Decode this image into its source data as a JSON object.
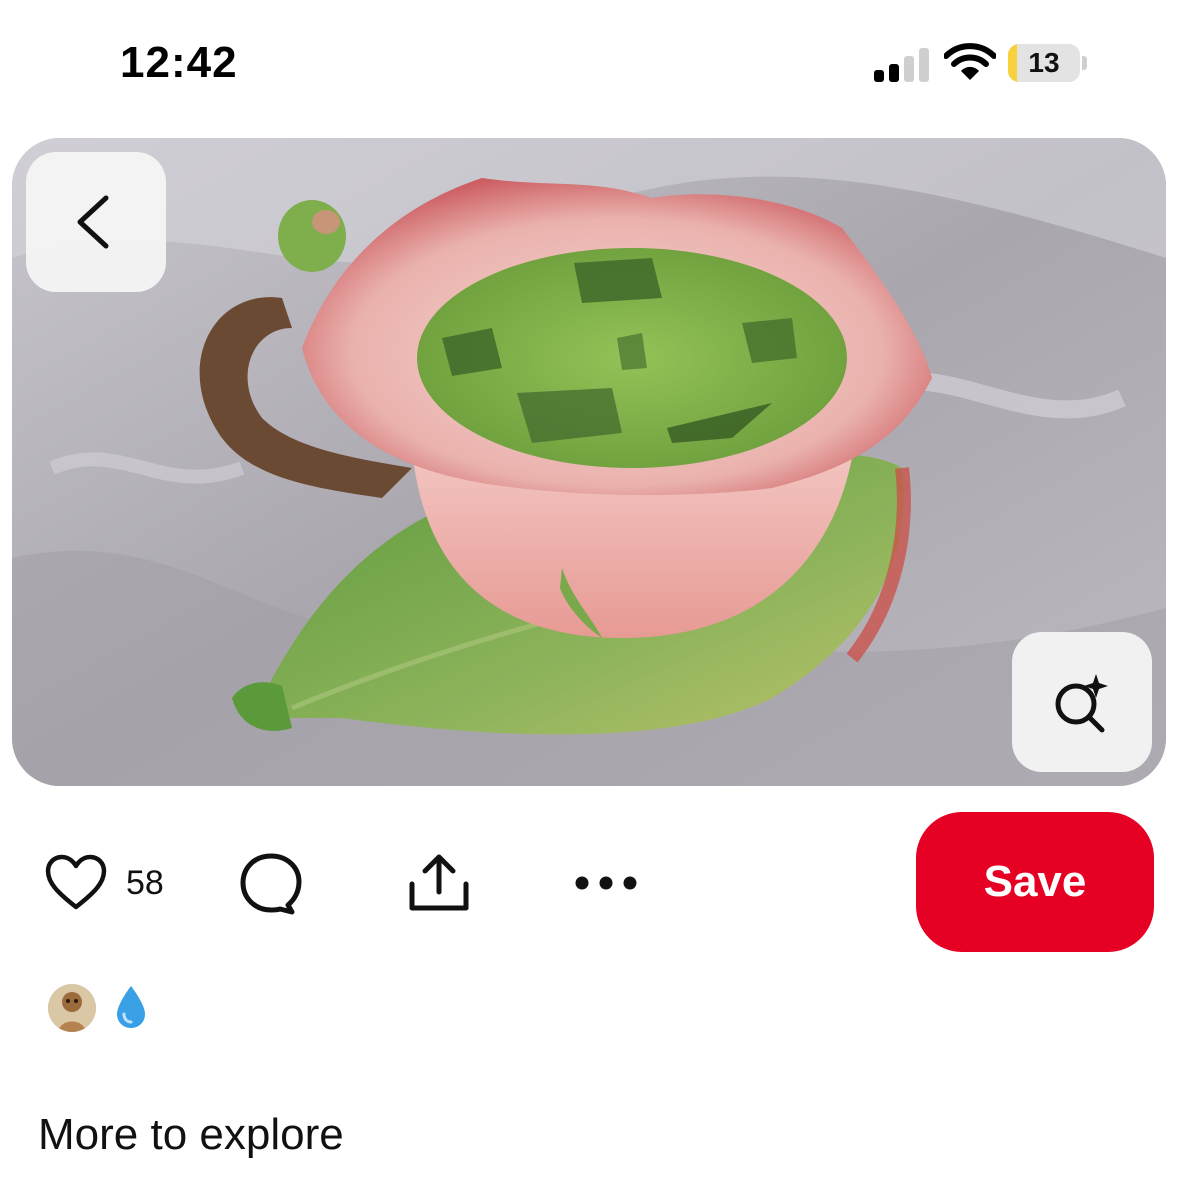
{
  "status_bar": {
    "time": "12:42",
    "battery_percent": "13",
    "battery_level": 0.13,
    "signal_bars_active": 2,
    "signal_bars_total": 4
  },
  "pin": {
    "back_icon": "chevron-left-icon",
    "visual_search_icon": "sparkle-search-icon"
  },
  "actions": {
    "like_icon": "heart-icon",
    "like_count": "58",
    "comment_icon": "comment-bubble-icon",
    "share_icon": "share-upload-icon",
    "more_icon": "more-dots-icon",
    "save_label": "Save"
  },
  "creator": {
    "avatar_icon": "creator-avatar",
    "badge_icon": "water-drop-icon"
  },
  "explore": {
    "title": "More to explore"
  },
  "colors": {
    "save_button": "#e60023",
    "text": "#111111",
    "battery_fill": "#f7d23c",
    "overlay_button": "#f5f5f5"
  }
}
